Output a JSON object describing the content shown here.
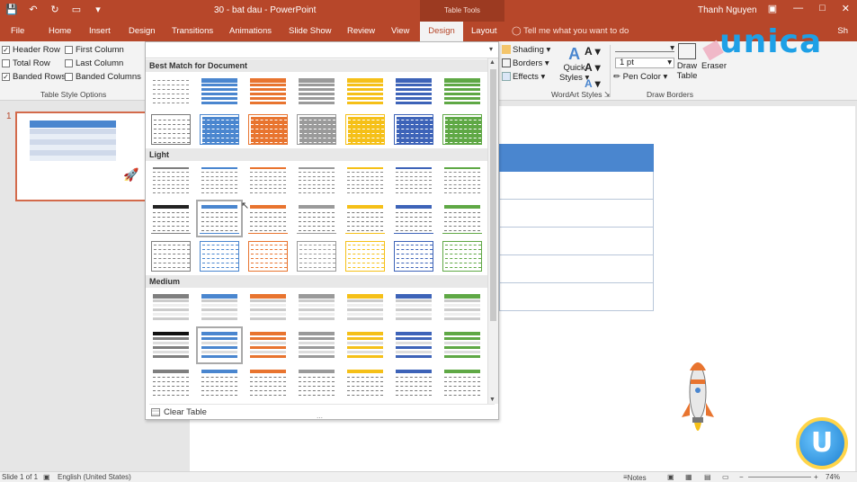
{
  "app": {
    "doc_title": "30 - bat dau - PowerPoint",
    "context_tab_group": "Table Tools",
    "user": "Thanh Nguyen",
    "share": "Sh"
  },
  "tabs": [
    "File",
    "Home",
    "Insert",
    "Design",
    "Transitions",
    "Animations",
    "Slide Show",
    "Review",
    "View",
    "Design",
    "Layout"
  ],
  "tell_me": "Tell me what you want to do",
  "style_options": {
    "header_row": "Header Row",
    "first_column": "First Column",
    "total_row": "Total Row",
    "last_column": "Last Column",
    "banded_rows": "Banded Rows",
    "banded_columns": "Banded Columns",
    "group_label": "Table Style Options"
  },
  "wordart": {
    "shading": "Shading",
    "borders": "Borders",
    "effects": "Effects",
    "quick": "Quick",
    "styles": "Styles",
    "group_label": "WordArt Styles"
  },
  "draw_borders": {
    "pen_weight": "1 pt",
    "pen_color": "Pen Color",
    "draw": "Draw",
    "table": "Table",
    "eraser": "Eraser",
    "group_label": "Draw Borders"
  },
  "gallery": {
    "sections": [
      "Best Match for Document",
      "Light",
      "Medium"
    ],
    "clear": "Clear Table",
    "colors": [
      "#7f7f7f",
      "#4a86cf",
      "#e8742f",
      "#9a9a9a",
      "#f5c018",
      "#3d63b8",
      "#5fa845"
    ]
  },
  "slide_pane": {
    "number": "1"
  },
  "watermark": {
    "brand": "unica",
    "badge": "U"
  },
  "status": {
    "slide": "Slide 1 of 1",
    "language": "English (United States)",
    "notes": "Notes",
    "zoom": "74%"
  }
}
